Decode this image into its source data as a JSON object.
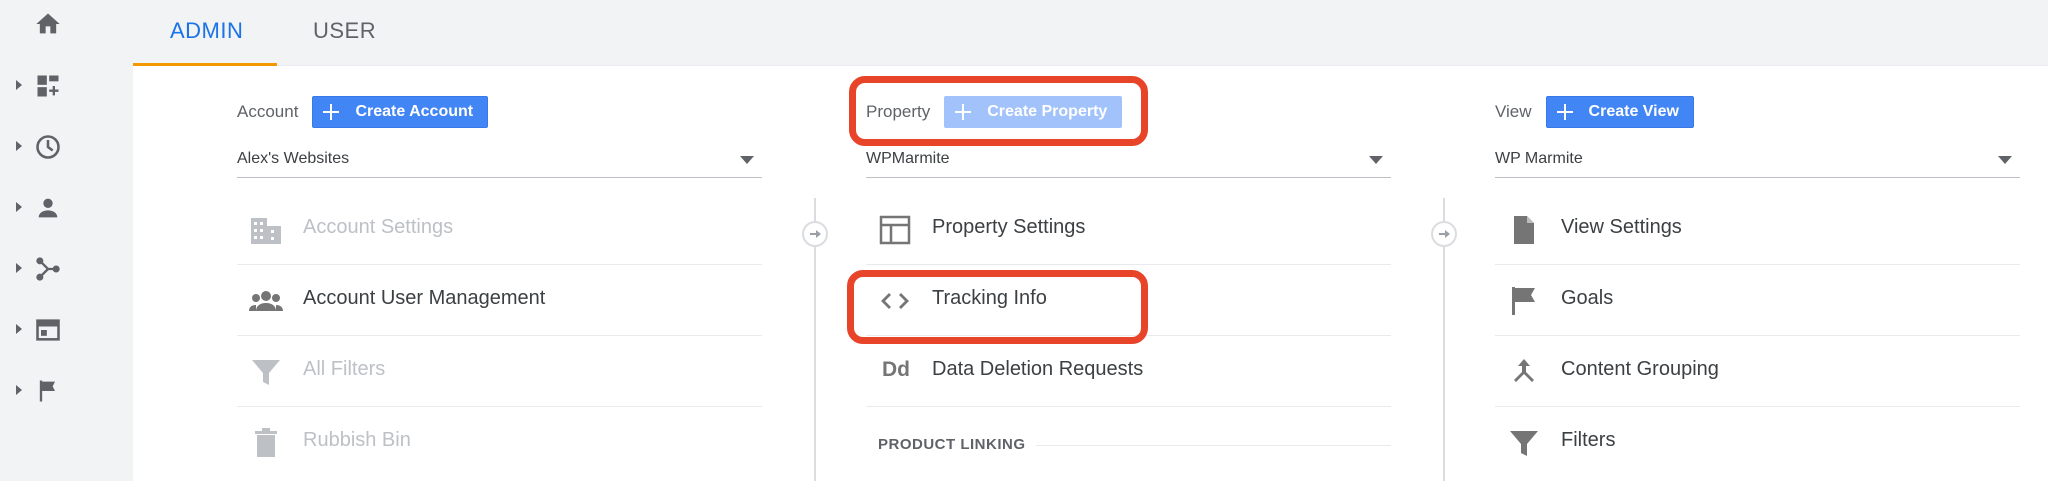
{
  "tabs": [
    {
      "label": "ADMIN",
      "active": true
    },
    {
      "label": "USER",
      "active": false
    }
  ],
  "rail": [
    {
      "icon": "home-icon",
      "arrow": false
    },
    {
      "icon": "dashboard-icon",
      "arrow": true
    },
    {
      "icon": "clock-icon",
      "arrow": true
    },
    {
      "icon": "person-icon",
      "arrow": true
    },
    {
      "icon": "acquisition-icon",
      "arrow": true
    },
    {
      "icon": "behavior-icon",
      "arrow": true
    },
    {
      "icon": "flag-icon",
      "arrow": true
    }
  ],
  "account": {
    "title": "Account",
    "create_label": "Create Account",
    "selected": "Alex's Websites",
    "items": [
      {
        "label": "Account Settings",
        "icon": "building-icon",
        "dim": true
      },
      {
        "label": "Account User Management",
        "icon": "people-icon",
        "dim": false
      },
      {
        "label": "All Filters",
        "icon": "filter-icon",
        "dim": true
      },
      {
        "label": "Rubbish Bin",
        "icon": "trash-icon",
        "dim": true
      }
    ]
  },
  "property": {
    "title": "Property",
    "create_label": "Create Property",
    "selected": "WPMarmite",
    "items": [
      {
        "label": "Property Settings",
        "icon": "layout-icon"
      },
      {
        "label": "Tracking Info",
        "icon": "code-icon"
      },
      {
        "label": "Data Deletion Requests",
        "icon": "dd-icon",
        "icon_text": "Dd"
      }
    ],
    "section_label": "PRODUCT LINKING"
  },
  "view": {
    "title": "View",
    "create_label": "Create View",
    "selected": "WP Marmite",
    "items": [
      {
        "label": "View Settings",
        "icon": "document-icon"
      },
      {
        "label": "Goals",
        "icon": "goal-flag-icon"
      },
      {
        "label": "Content Grouping",
        "icon": "merge-icon"
      },
      {
        "label": "Filters",
        "icon": "filter-icon"
      }
    ]
  },
  "colors": {
    "accent": "#1a73e8",
    "button": "#4285f4",
    "tab_underline": "#f29900",
    "highlight": "#e8442a"
  }
}
